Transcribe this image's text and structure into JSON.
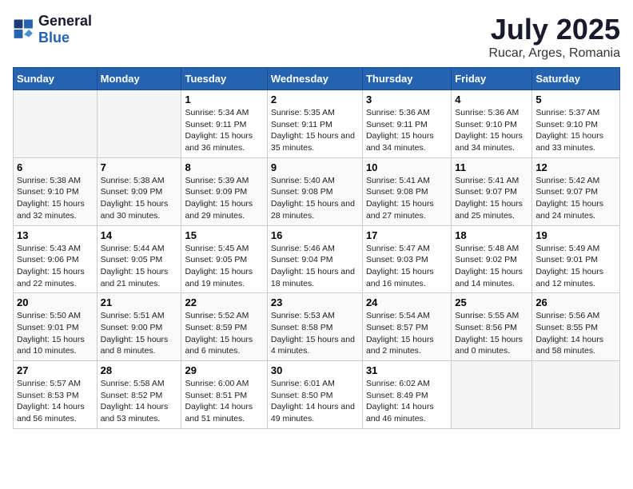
{
  "logo": {
    "general": "General",
    "blue": "Blue"
  },
  "title": "July 2025",
  "subtitle": "Rucar, Arges, Romania",
  "header_days": [
    "Sunday",
    "Monday",
    "Tuesday",
    "Wednesday",
    "Thursday",
    "Friday",
    "Saturday"
  ],
  "weeks": [
    [
      {
        "day": "",
        "sunrise": "",
        "sunset": "",
        "daylight": "",
        "empty": true
      },
      {
        "day": "",
        "sunrise": "",
        "sunset": "",
        "daylight": "",
        "empty": true
      },
      {
        "day": "1",
        "sunrise": "Sunrise: 5:34 AM",
        "sunset": "Sunset: 9:11 PM",
        "daylight": "Daylight: 15 hours and 36 minutes."
      },
      {
        "day": "2",
        "sunrise": "Sunrise: 5:35 AM",
        "sunset": "Sunset: 9:11 PM",
        "daylight": "Daylight: 15 hours and 35 minutes."
      },
      {
        "day": "3",
        "sunrise": "Sunrise: 5:36 AM",
        "sunset": "Sunset: 9:11 PM",
        "daylight": "Daylight: 15 hours and 34 minutes."
      },
      {
        "day": "4",
        "sunrise": "Sunrise: 5:36 AM",
        "sunset": "Sunset: 9:10 PM",
        "daylight": "Daylight: 15 hours and 34 minutes."
      },
      {
        "day": "5",
        "sunrise": "Sunrise: 5:37 AM",
        "sunset": "Sunset: 9:10 PM",
        "daylight": "Daylight: 15 hours and 33 minutes."
      }
    ],
    [
      {
        "day": "6",
        "sunrise": "Sunrise: 5:38 AM",
        "sunset": "Sunset: 9:10 PM",
        "daylight": "Daylight: 15 hours and 32 minutes."
      },
      {
        "day": "7",
        "sunrise": "Sunrise: 5:38 AM",
        "sunset": "Sunset: 9:09 PM",
        "daylight": "Daylight: 15 hours and 30 minutes."
      },
      {
        "day": "8",
        "sunrise": "Sunrise: 5:39 AM",
        "sunset": "Sunset: 9:09 PM",
        "daylight": "Daylight: 15 hours and 29 minutes."
      },
      {
        "day": "9",
        "sunrise": "Sunrise: 5:40 AM",
        "sunset": "Sunset: 9:08 PM",
        "daylight": "Daylight: 15 hours and 28 minutes."
      },
      {
        "day": "10",
        "sunrise": "Sunrise: 5:41 AM",
        "sunset": "Sunset: 9:08 PM",
        "daylight": "Daylight: 15 hours and 27 minutes."
      },
      {
        "day": "11",
        "sunrise": "Sunrise: 5:41 AM",
        "sunset": "Sunset: 9:07 PM",
        "daylight": "Daylight: 15 hours and 25 minutes."
      },
      {
        "day": "12",
        "sunrise": "Sunrise: 5:42 AM",
        "sunset": "Sunset: 9:07 PM",
        "daylight": "Daylight: 15 hours and 24 minutes."
      }
    ],
    [
      {
        "day": "13",
        "sunrise": "Sunrise: 5:43 AM",
        "sunset": "Sunset: 9:06 PM",
        "daylight": "Daylight: 15 hours and 22 minutes."
      },
      {
        "day": "14",
        "sunrise": "Sunrise: 5:44 AM",
        "sunset": "Sunset: 9:05 PM",
        "daylight": "Daylight: 15 hours and 21 minutes."
      },
      {
        "day": "15",
        "sunrise": "Sunrise: 5:45 AM",
        "sunset": "Sunset: 9:05 PM",
        "daylight": "Daylight: 15 hours and 19 minutes."
      },
      {
        "day": "16",
        "sunrise": "Sunrise: 5:46 AM",
        "sunset": "Sunset: 9:04 PM",
        "daylight": "Daylight: 15 hours and 18 minutes."
      },
      {
        "day": "17",
        "sunrise": "Sunrise: 5:47 AM",
        "sunset": "Sunset: 9:03 PM",
        "daylight": "Daylight: 15 hours and 16 minutes."
      },
      {
        "day": "18",
        "sunrise": "Sunrise: 5:48 AM",
        "sunset": "Sunset: 9:02 PM",
        "daylight": "Daylight: 15 hours and 14 minutes."
      },
      {
        "day": "19",
        "sunrise": "Sunrise: 5:49 AM",
        "sunset": "Sunset: 9:01 PM",
        "daylight": "Daylight: 15 hours and 12 minutes."
      }
    ],
    [
      {
        "day": "20",
        "sunrise": "Sunrise: 5:50 AM",
        "sunset": "Sunset: 9:01 PM",
        "daylight": "Daylight: 15 hours and 10 minutes."
      },
      {
        "day": "21",
        "sunrise": "Sunrise: 5:51 AM",
        "sunset": "Sunset: 9:00 PM",
        "daylight": "Daylight: 15 hours and 8 minutes."
      },
      {
        "day": "22",
        "sunrise": "Sunrise: 5:52 AM",
        "sunset": "Sunset: 8:59 PM",
        "daylight": "Daylight: 15 hours and 6 minutes."
      },
      {
        "day": "23",
        "sunrise": "Sunrise: 5:53 AM",
        "sunset": "Sunset: 8:58 PM",
        "daylight": "Daylight: 15 hours and 4 minutes."
      },
      {
        "day": "24",
        "sunrise": "Sunrise: 5:54 AM",
        "sunset": "Sunset: 8:57 PM",
        "daylight": "Daylight: 15 hours and 2 minutes."
      },
      {
        "day": "25",
        "sunrise": "Sunrise: 5:55 AM",
        "sunset": "Sunset: 8:56 PM",
        "daylight": "Daylight: 15 hours and 0 minutes."
      },
      {
        "day": "26",
        "sunrise": "Sunrise: 5:56 AM",
        "sunset": "Sunset: 8:55 PM",
        "daylight": "Daylight: 14 hours and 58 minutes."
      }
    ],
    [
      {
        "day": "27",
        "sunrise": "Sunrise: 5:57 AM",
        "sunset": "Sunset: 8:53 PM",
        "daylight": "Daylight: 14 hours and 56 minutes."
      },
      {
        "day": "28",
        "sunrise": "Sunrise: 5:58 AM",
        "sunset": "Sunset: 8:52 PM",
        "daylight": "Daylight: 14 hours and 53 minutes."
      },
      {
        "day": "29",
        "sunrise": "Sunrise: 6:00 AM",
        "sunset": "Sunset: 8:51 PM",
        "daylight": "Daylight: 14 hours and 51 minutes."
      },
      {
        "day": "30",
        "sunrise": "Sunrise: 6:01 AM",
        "sunset": "Sunset: 8:50 PM",
        "daylight": "Daylight: 14 hours and 49 minutes."
      },
      {
        "day": "31",
        "sunrise": "Sunrise: 6:02 AM",
        "sunset": "Sunset: 8:49 PM",
        "daylight": "Daylight: 14 hours and 46 minutes."
      },
      {
        "day": "",
        "sunrise": "",
        "sunset": "",
        "daylight": "",
        "empty": true
      },
      {
        "day": "",
        "sunrise": "",
        "sunset": "",
        "daylight": "",
        "empty": true
      }
    ]
  ]
}
